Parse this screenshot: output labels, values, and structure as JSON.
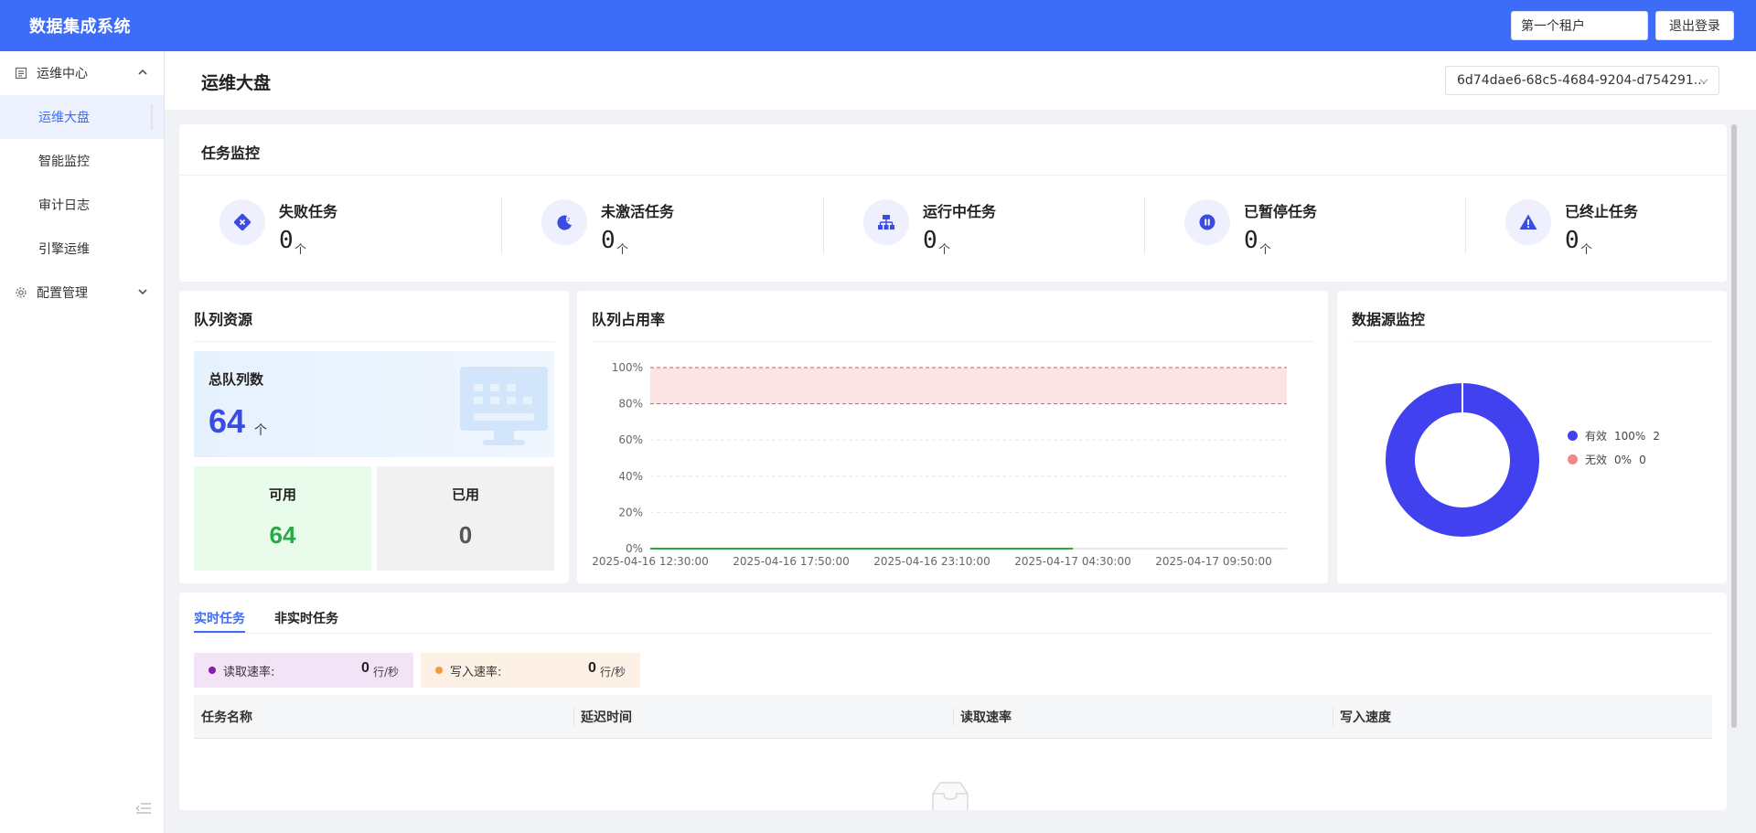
{
  "header": {
    "app_title": "数据集成系统",
    "tenant": "第一个租户",
    "logout_label": "退出登录"
  },
  "sidebar": {
    "groups": [
      {
        "label": "运维中心",
        "icon": "list-icon",
        "expanded": true,
        "items": [
          {
            "label": "运维大盘",
            "active": true
          },
          {
            "label": "智能监控"
          },
          {
            "label": "审计日志"
          },
          {
            "label": "引擎运维"
          }
        ]
      },
      {
        "label": "配置管理",
        "icon": "gear-icon",
        "expanded": false,
        "items": []
      }
    ]
  },
  "page": {
    "title": "运维大盘",
    "project_id": "6d74dae6-68c5-4684-9204-d754291..."
  },
  "task_monitor": {
    "title": "任务监控",
    "stats": [
      {
        "label": "失败任务",
        "value": "0",
        "unit": "个",
        "icon": "failed-task-icon"
      },
      {
        "label": "未激活任务",
        "value": "0",
        "unit": "个",
        "icon": "moon-sleep-icon"
      },
      {
        "label": "运行中任务",
        "value": "0",
        "unit": "个",
        "icon": "sitemap-icon"
      },
      {
        "label": "已暂停任务",
        "value": "0",
        "unit": "个",
        "icon": "pause-icon"
      },
      {
        "label": "已终止任务",
        "value": "0",
        "unit": "个",
        "icon": "warning-icon"
      }
    ]
  },
  "queue_resource": {
    "title": "队列资源",
    "total_label": "总队列数",
    "total_value": "64",
    "total_unit": "个",
    "available_label": "可用",
    "available_value": "64",
    "used_label": "已用",
    "used_value": "0"
  },
  "chart_data": [
    {
      "type": "line",
      "title": "队列占用率",
      "x": [
        "2025-04-16 12:30:00",
        "2025-04-16 17:50:00",
        "2025-04-16 23:10:00",
        "2025-04-17 04:30:00",
        "2025-04-17 09:50:00"
      ],
      "xlabel": "",
      "ylabel": "",
      "yticks": [
        "0%",
        "20%",
        "40%",
        "60%",
        "80%",
        "100%"
      ],
      "ylim": [
        0,
        100
      ],
      "series": [
        {
          "color": "#27a94a",
          "x_range": [
            "2025-04-16 12:30:00",
            "2025-04-17 04:30:00"
          ],
          "values": [
            0,
            0
          ]
        }
      ],
      "threshold_band": {
        "from": 80,
        "to": 100,
        "color": "#fde4e4"
      },
      "grid": true
    },
    {
      "type": "pie",
      "title": "数据源监控",
      "slices": [
        {
          "name": "有效",
          "percent": "100%",
          "count": "2",
          "value": 2,
          "color": "#4141ef"
        },
        {
          "name": "无效",
          "percent": "0%",
          "count": "0",
          "value": 0,
          "color": "#f08a8a"
        }
      ],
      "legend_position": "right"
    }
  ],
  "realtime": {
    "tabs": [
      "实时任务",
      "非实时任务"
    ],
    "read_rate_label": "读取速率:",
    "read_rate_value": "0",
    "read_rate_unit": "行/秒",
    "write_rate_label": "写入速率:",
    "write_rate_value": "0",
    "write_rate_unit": "行/秒",
    "columns": [
      "任务名称",
      "延迟时间",
      "读取速率",
      "写入速度"
    ],
    "rows": []
  }
}
